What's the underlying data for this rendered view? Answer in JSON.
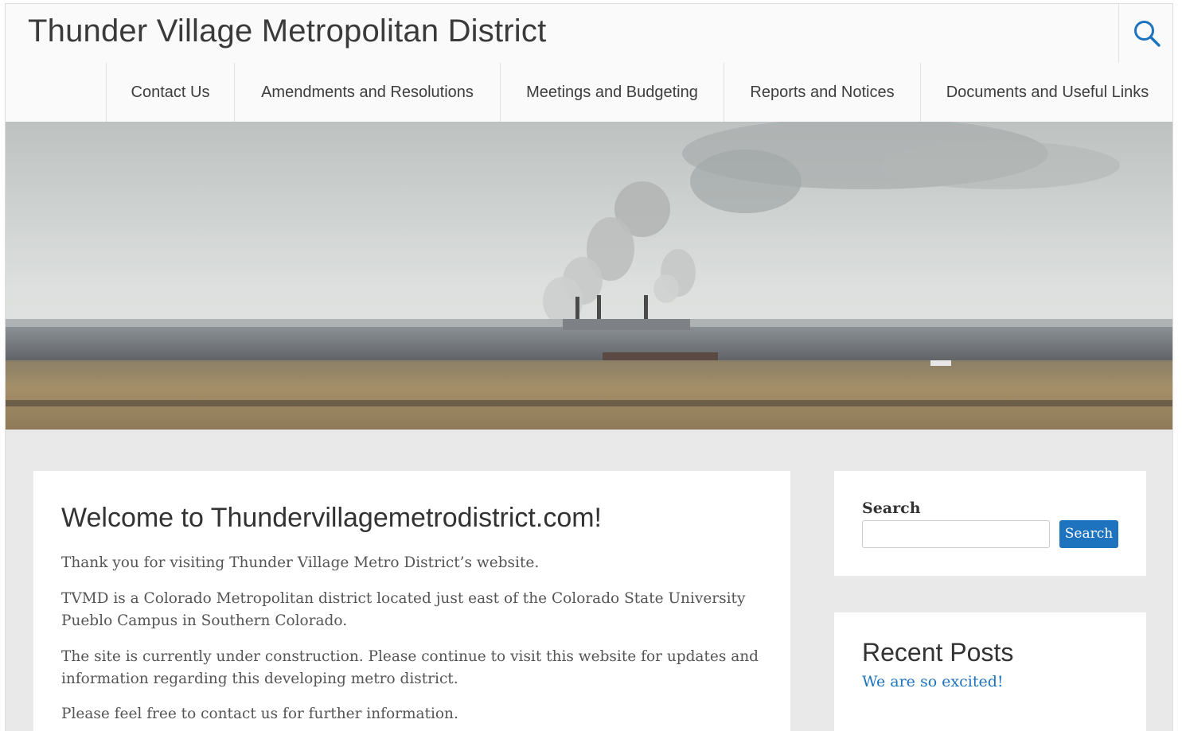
{
  "site": {
    "title": "Thunder Village Metropolitan District"
  },
  "header": {
    "search_icon": "search-icon"
  },
  "nav": {
    "items": [
      {
        "label": "Contact Us"
      },
      {
        "label": "Amendments and Resolutions"
      },
      {
        "label": "Meetings and Budgeting"
      },
      {
        "label": "Reports and Notices"
      },
      {
        "label": "Documents and Useful Links"
      }
    ]
  },
  "hero": {
    "image": "landscape-with-smokestacks"
  },
  "main": {
    "title": "Welcome to Thundervillagemetrodistrict.com!",
    "paragraphs": [
      "Thank you for visiting Thunder Village Metro District’s website.",
      "TVMD is a Colorado Metropolitan district located just east of the Colorado State University Pueblo Campus in Southern Colorado.",
      "The site is currently under construction. Please continue to visit this website for updates and information regarding this developing metro district.",
      "Please feel free to contact us for further information."
    ]
  },
  "sidebar": {
    "search": {
      "label": "Search",
      "placeholder": "",
      "button_label": "Search"
    },
    "recent_posts": {
      "title": "Recent Posts",
      "items": [
        {
          "label": "We are so excited!"
        }
      ]
    }
  },
  "colors": {
    "accent": "#1e73be",
    "background": "#e9e9e9",
    "header": "#fafafa",
    "text": "#3a3a3a"
  }
}
